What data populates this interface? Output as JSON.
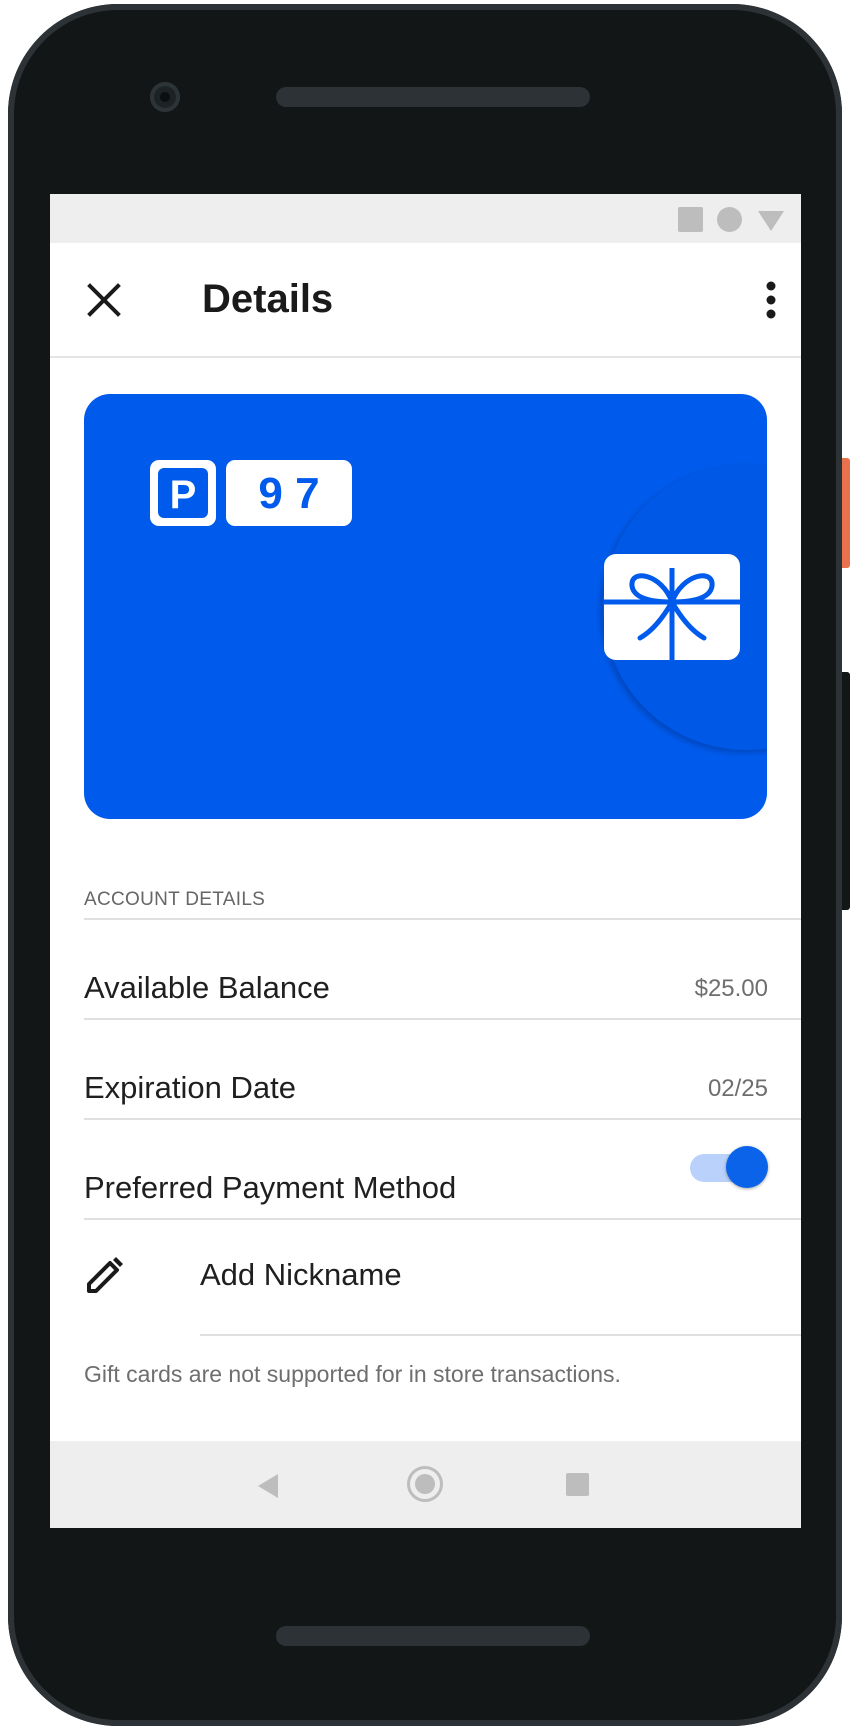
{
  "header": {
    "title": "Details"
  },
  "card": {
    "logo_letter": "P",
    "logo_number": "9 7",
    "brand_color": "#005bec",
    "icon": "gift-card-icon"
  },
  "account": {
    "section_label": "ACCOUNT DETAILS",
    "rows": [
      {
        "label": "Available Balance",
        "value": "$25.00"
      },
      {
        "label": "Expiration Date",
        "value": "02/25"
      }
    ],
    "preferred": {
      "label": "Preferred Payment Method",
      "enabled": true
    }
  },
  "nickname": {
    "label": "Add Nickname",
    "icon": "pencil-icon"
  },
  "note": "Gift cards are not supported for in store transactions.",
  "colors": {
    "accent": "#0a63e8",
    "toggle_track": "#b9d1fb"
  }
}
